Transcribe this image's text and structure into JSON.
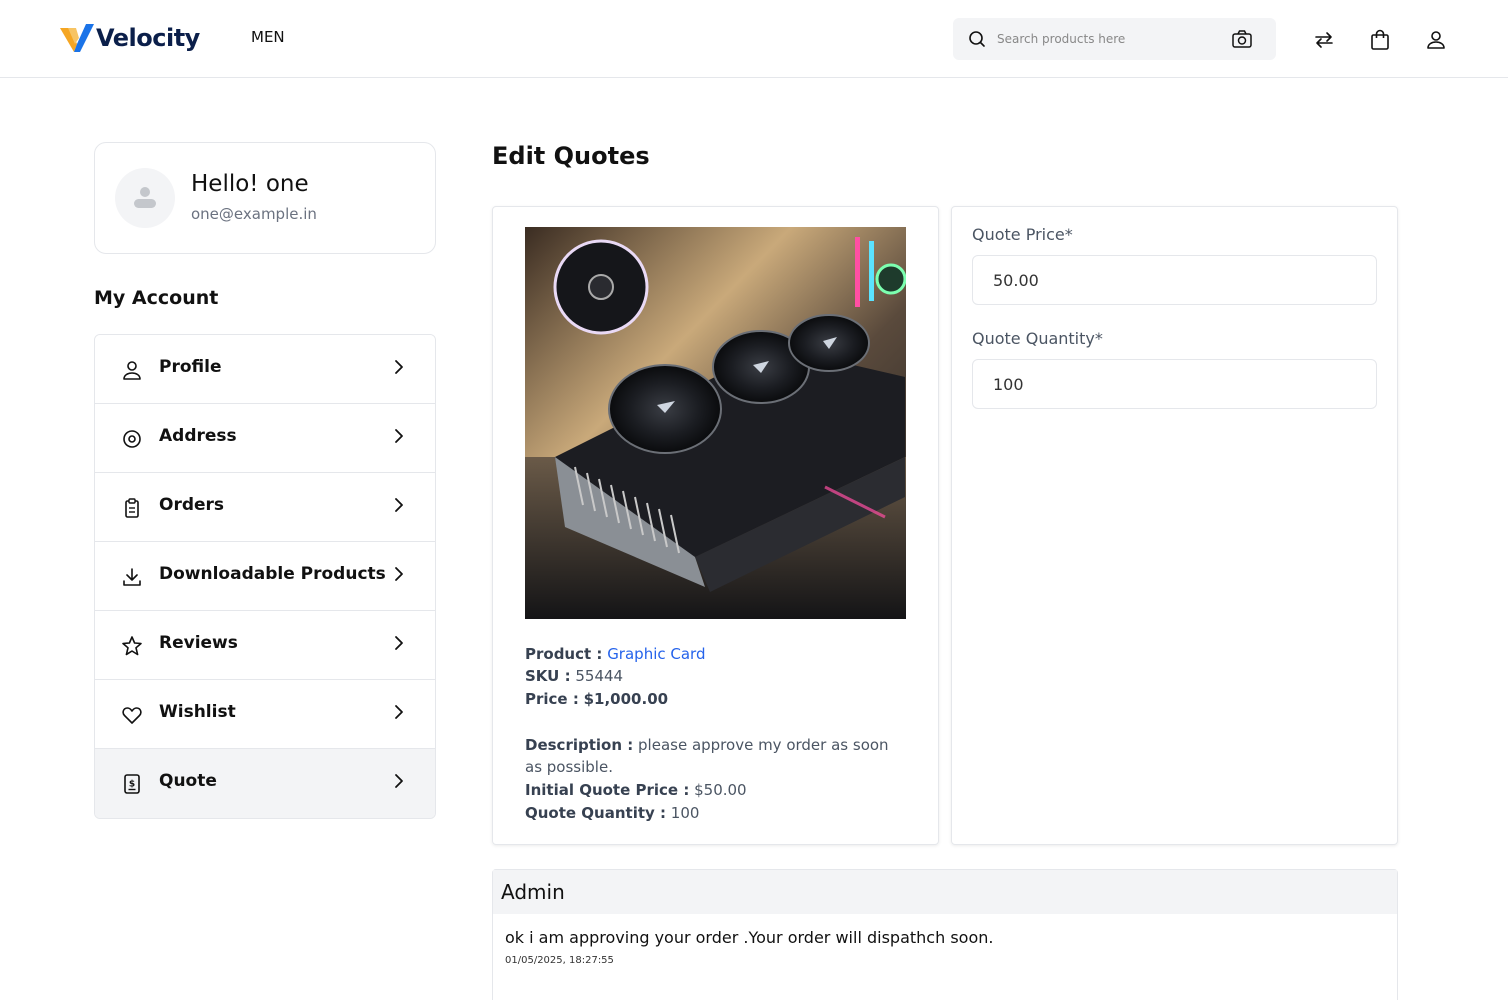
{
  "header": {
    "logo_text": "Velocity",
    "nav_men": "MEN",
    "search_placeholder": "Search products here"
  },
  "profile": {
    "greeting": "Hello! one",
    "email": "one@example.in"
  },
  "sidebar": {
    "title": "My Account",
    "items": [
      {
        "label": "Profile",
        "icon": "user-icon"
      },
      {
        "label": "Address",
        "icon": "map-pin-icon"
      },
      {
        "label": "Orders",
        "icon": "clipboard-icon"
      },
      {
        "label": "Downloadable Products",
        "icon": "download-icon"
      },
      {
        "label": "Reviews",
        "icon": "star-icon"
      },
      {
        "label": "Wishlist",
        "icon": "heart-icon"
      },
      {
        "label": "Quote",
        "icon": "invoice-icon",
        "active": true
      }
    ]
  },
  "main": {
    "title": "Edit Quotes",
    "product": {
      "product_label": "Product :",
      "product_name": "Graphic Card",
      "sku_label": "SKU :",
      "sku": "55444",
      "price_label": "Price :",
      "price": "$1,000.00",
      "description_label": "Description :",
      "description": "please approve my order as soon as possible.",
      "initial_price_label": "Initial Quote Price :",
      "initial_price": "$50.00",
      "quote_qty_label": "Quote Quantity :",
      "quote_qty": "100"
    },
    "form": {
      "price_label": "Quote Price*",
      "price_value": "50.00",
      "qty_label": "Quote Quantity*",
      "qty_value": "100"
    },
    "admin": {
      "title": "Admin",
      "message": "ok i am approving your order .Your order will dispathch soon.",
      "timestamp": "01/05/2025, 18:27:55"
    }
  },
  "colors": {
    "accent": "#2563eb",
    "logo_navy": "#0b1f4a",
    "logo_orange": "#f5a623",
    "panel_bg": "#f3f4f6"
  }
}
